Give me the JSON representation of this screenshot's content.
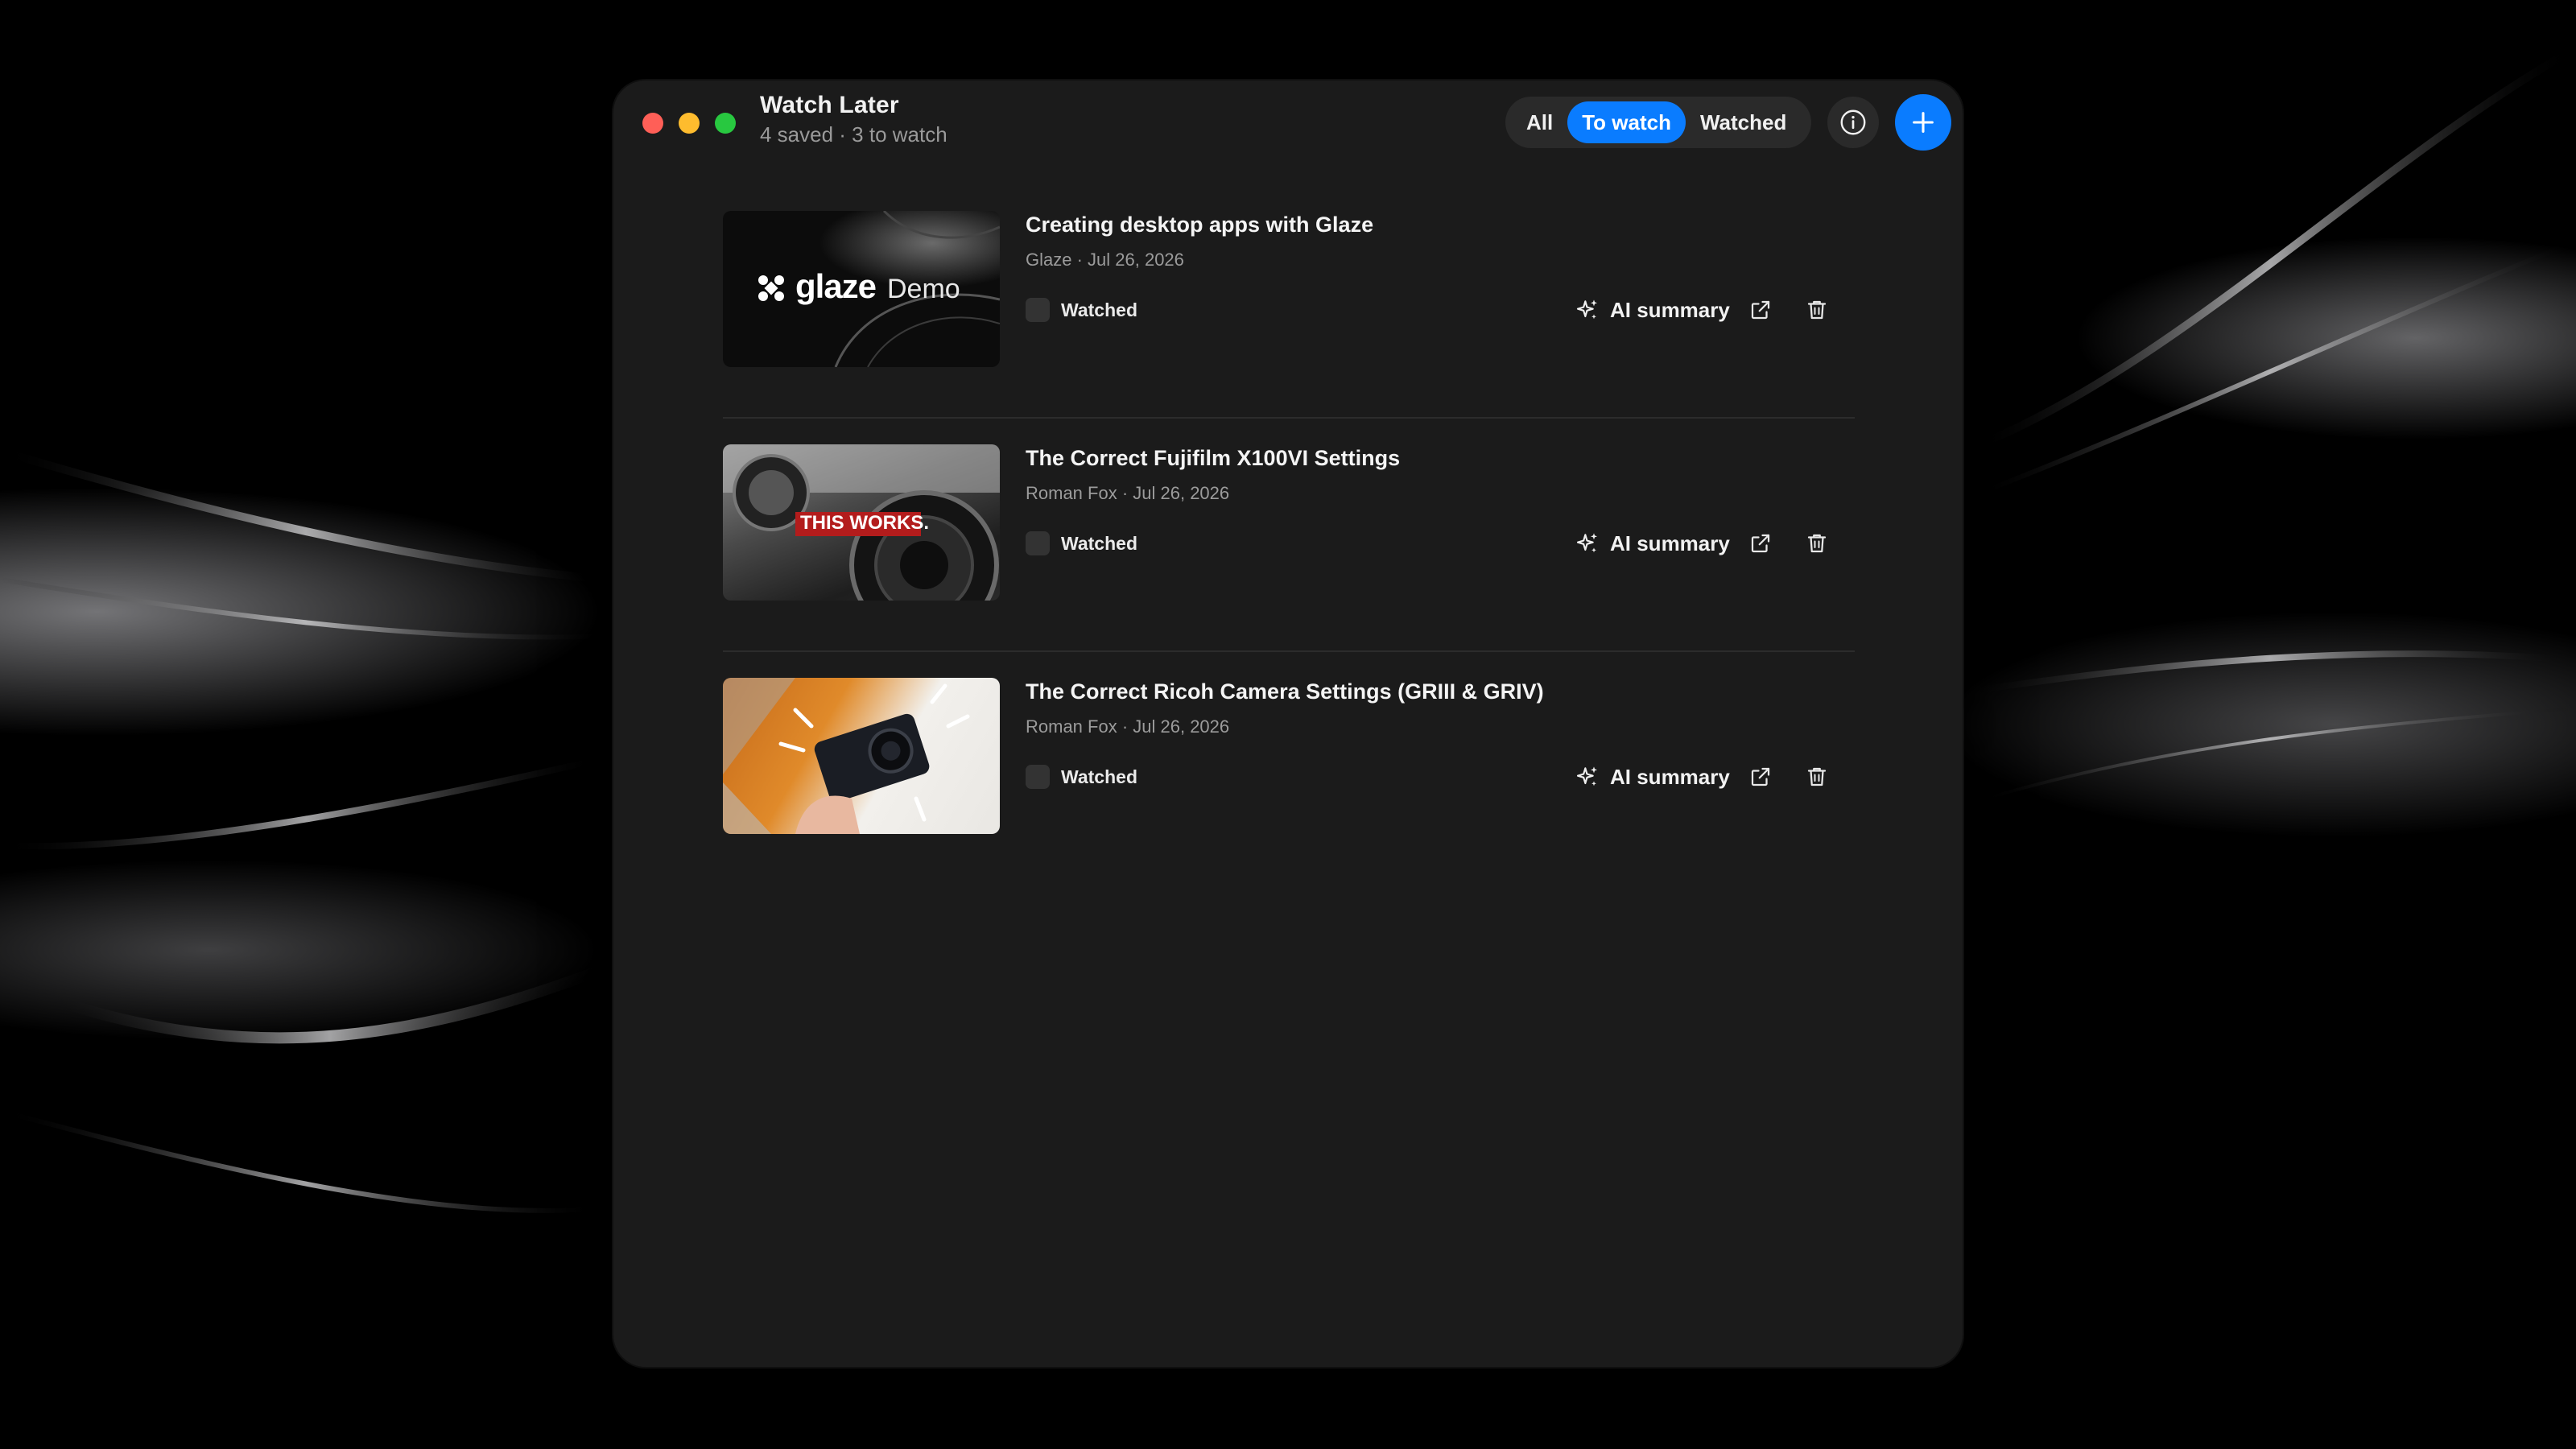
{
  "window": {
    "title": "Watch Later",
    "subtitle": "4 saved · 3 to watch"
  },
  "filters": {
    "items": [
      {
        "label": "All",
        "active": false
      },
      {
        "label": "To watch",
        "active": true
      },
      {
        "label": "Watched",
        "active": false
      }
    ]
  },
  "toolbar": {
    "info_icon": "info-icon",
    "add_icon": "plus-icon"
  },
  "videos": [
    {
      "title": "Creating desktop apps with Glaze",
      "meta": "Glaze · Jul 26, 2026",
      "watched_label": "Watched",
      "watched": false,
      "ai_label": "AI summary",
      "thumb_brand": "glaze",
      "thumb_caption": "Demo"
    },
    {
      "title": "The Correct Fujifilm X100VI Settings",
      "meta": "Roman Fox · Jul 26, 2026",
      "watched_label": "Watched",
      "watched": false,
      "ai_label": "AI summary",
      "thumb_caption": "THIS WORKS."
    },
    {
      "title": "The Correct Ricoh Camera Settings (GRIII & GRIV)",
      "meta": "Roman Fox · Jul 26, 2026",
      "watched_label": "Watched",
      "watched": false,
      "ai_label": "AI summary"
    }
  ],
  "colors": {
    "accent": "#0a7cff",
    "window_bg": "#1b1b1b",
    "close": "#ff5f57",
    "minimize": "#febc2e",
    "maximize": "#28c840"
  }
}
